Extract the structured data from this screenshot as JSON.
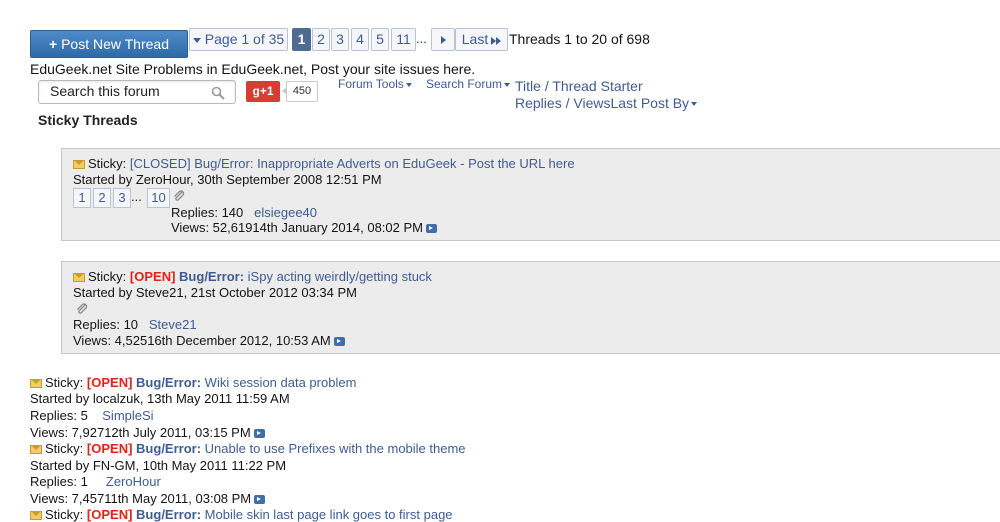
{
  "toolbar": {
    "post_label": "Post New Thread",
    "page_label": "Page 1 of 35",
    "pages": [
      "1",
      "2",
      "3",
      "4",
      "5",
      "11"
    ],
    "ellipsis": "...",
    "last_label": "Last",
    "threads_count": "Threads 1 to 20 of 698"
  },
  "forum": {
    "description": "EduGeek.net Site Problems in EduGeek.net, Post your site issues here.",
    "search_placeholder": "Search this forum",
    "gplus_label": "g+1",
    "gplus_count": "450",
    "tools_label": "Forum Tools",
    "search_label": "Search Forum",
    "sort_title": "Title",
    "sort_sep1": " / ",
    "sort_starter": "Thread Starter",
    "sort_replies": "Replies",
    "sort_sep2": " / ",
    "sort_views": "Views",
    "sort_last": "Last Post By",
    "sticky_heading": "Sticky Threads"
  },
  "threads": [
    {
      "sticky": "Sticky:",
      "title": "[CLOSED] Bug/Error: Inappropriate Adverts on EduGeek - Post the URL here",
      "started": "Started by ZeroHour, 30th September 2008 12:51 PM",
      "mini_pages": [
        "1",
        "2",
        "3",
        "10"
      ],
      "mini_ellipsis": "...",
      "replies_label": "Replies: 140",
      "last_user": "elsiegee40",
      "views_line": "Views: 52,61914th January 2014, 08:02 PM"
    },
    {
      "sticky": "Sticky:",
      "open_tag": "[OPEN]",
      "prefix": "Bug/Error:",
      "title": "iSpy acting weirdly/getting stuck",
      "started": "Started by Steve21, 21st October 2012 03:34 PM",
      "replies_label": "Replies: 10",
      "last_user": "Steve21",
      "views_line": "Views: 4,52516th December 2012, 10:53 AM"
    },
    {
      "sticky": "Sticky:",
      "open_tag": "[OPEN]",
      "prefix": "Bug/Error:",
      "title": "Wiki session data problem",
      "started": "Started by localzuk, 13th May 2011 11:59 AM",
      "replies_label": "Replies: 5",
      "last_user": "SimpleSi",
      "views_line": "Views: 7,92712th July 2011, 03:15 PM"
    },
    {
      "sticky": "Sticky:",
      "open_tag": "[OPEN]",
      "prefix": "Bug/Error:",
      "title": "Unable to use Prefixes with the mobile theme",
      "started": "Started by FN-GM, 10th May 2011 11:22 PM",
      "replies_label": "Replies: 1",
      "last_user": "ZeroHour",
      "views_line": "Views: 7,45711th May 2011, 03:08 PM"
    },
    {
      "sticky": "Sticky:",
      "open_tag": "[OPEN]",
      "prefix": "Bug/Error:",
      "title": "Mobile skin last page link goes to first page"
    }
  ],
  "colors": {
    "link": "#3e5c92",
    "open_red": "#e0221b",
    "post_button": "#3a78b8",
    "current_page": "#4e6b93"
  }
}
